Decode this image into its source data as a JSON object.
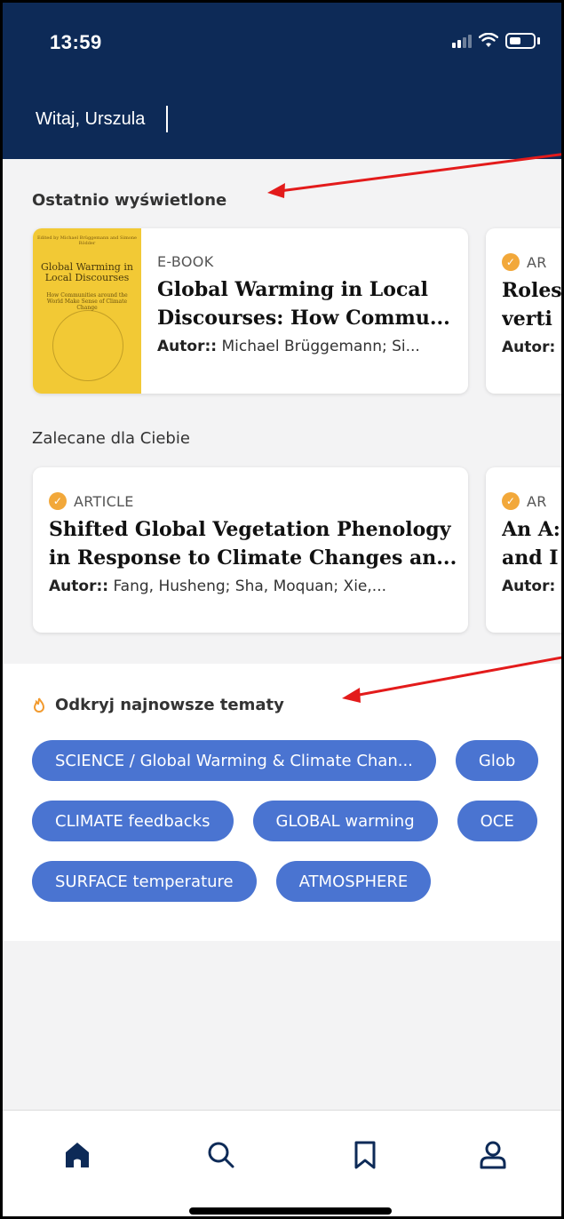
{
  "status": {
    "time": "13:59"
  },
  "header": {
    "greeting": "Witaj, Urszula"
  },
  "recent": {
    "title": "Ostatnio wyświetlone",
    "cards": [
      {
        "type": "E-BOOK",
        "title": "Global Warming in Local Discourses: How Commu...",
        "author_label": "Autor::",
        "author": "Michael Brüggemann; Si...",
        "cover": {
          "top": "Edited by Michael Brüggemann and Simone Rödder",
          "title": "Global Warming in Local Discourses",
          "subtitle": "How Communities around the World Make Sense of Climate Change"
        }
      },
      {
        "type": "AR",
        "title": "Roles verti",
        "author_label": "Autor:"
      }
    ]
  },
  "recommended": {
    "title": "Zalecane dla Ciebie",
    "cards": [
      {
        "type": "ARTICLE",
        "title": "Shifted Global Vegetation Phenology in Response to Climate Changes an...",
        "author_label": "Autor::",
        "author": "Fang, Husheng; Sha, Moquan; Xie,..."
      },
      {
        "type": "AR",
        "title": "An A: and I",
        "author_label": "Autor:"
      }
    ]
  },
  "topics": {
    "title": "Odkryj najnowsze tematy",
    "rows": [
      [
        "SCIENCE / Global Warming & Climate Chan...",
        "Glob"
      ],
      [
        "CLIMATE feedbacks",
        "GLOBAL warming",
        "OCE"
      ],
      [
        "SURFACE temperature",
        "ATMOSPHERE"
      ]
    ]
  },
  "tabs": [
    "home-icon",
    "search-icon",
    "bookmark-icon",
    "profile-icon"
  ],
  "colors": {
    "header": "#0d2a57",
    "chip": "#4a74d1",
    "badge": "#f2a83a",
    "arrow": "#e31b1b"
  }
}
